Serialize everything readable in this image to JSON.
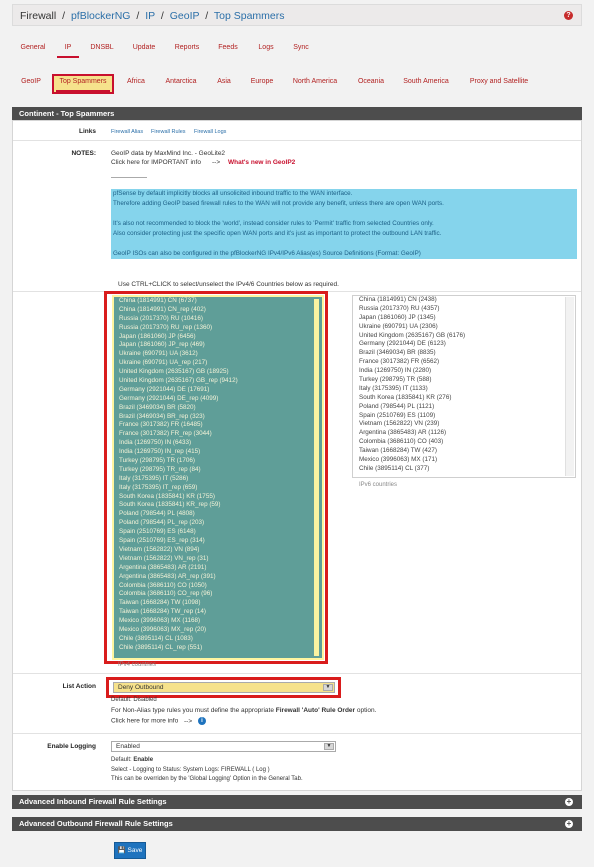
{
  "header": {
    "root": "Firewall",
    "crumbs": [
      "pfBlockerNG",
      "IP",
      "GeoIP",
      "Top Spammers"
    ],
    "sep": "/"
  },
  "main_tabs": [
    "General",
    "IP",
    "DNSBL",
    "Update",
    "Reports",
    "Feeds",
    "Logs",
    "Sync"
  ],
  "sub_tabs": [
    "GeoIP",
    "Top Spammers",
    "Africa",
    "Antarctica",
    "Asia",
    "Europe",
    "North America",
    "Oceania",
    "South America",
    "Proxy and Satellite"
  ],
  "panel_title": "Continent - Top Spammers",
  "links": {
    "label": "Links",
    "items": [
      "Firewall Alias",
      "Firewall Rules",
      "Firewall Logs"
    ]
  },
  "notes": {
    "label": "NOTES:",
    "line1": "GeoIP data by MaxMind Inc. - GeoLite2",
    "line2": "Click here for IMPORTANT info",
    "arrow": "-->",
    "whats_new": "What's new in GeoIP2",
    "info_lines": [
      "pfSense by default implicitly blocks all unsolicited inbound traffic to the WAN interface.",
      "Therefore adding GeoIP based firewall rules to the WAN will not provide any benefit, unless there are open WAN ports.",
      "",
      "It's also not recommended to block the 'world', instead consider rules to 'Permit' traffic from selected Countries only.",
      "Also consider protecting just the specific open WAN ports and it's just as important to protect the outbound LAN traffic.",
      "",
      "GeoIP ISOs can also be configured in the pfBlockerNG IPv4/IPv6 Alias(es) Source Definitions (Format: GeoIP)"
    ],
    "use_line": "Use    CTRL+CLICK    to    select/unselect    the IPv4/6 Countries below as required."
  },
  "ipv4_countries": [
    "China (1814991) CN (6737)",
    "China (1814991) CN_rep (402)",
    "Russia (2017370) RU (10416)",
    "Russia (2017370) RU_rep (1360)",
    "Japan (1861060) JP (6456)",
    "Japan (1861060) JP_rep (469)",
    "Ukraine (690791) UA (3612)",
    "Ukraine (690791) UA_rep (217)",
    "United Kingdom (2635167) GB (18925)",
    "United Kingdom (2635167) GB_rep (9412)",
    "Germany (2921044) DE (17691)",
    "Germany (2921044) DE_rep (4099)",
    "Brazil (3469034) BR (5820)",
    "Brazil (3469034) BR_rep (323)",
    "France (3017382) FR (16485)",
    "France (3017382) FR_rep (3044)",
    "India (1269750) IN (6433)",
    "India (1269750) IN_rep (415)",
    "Turkey (298795) TR (1706)",
    "Turkey (298795) TR_rep (84)",
    "Italy (3175395) IT (5286)",
    "Italy (3175395) IT_rep (659)",
    "South Korea (1835841) KR (1755)",
    "South Korea (1835841) KR_rep (59)",
    "Poland (798544) PL (4808)",
    "Poland (798544) PL_rep (203)",
    "Spain (2510769) ES (6148)",
    "Spain (2510769) ES_rep (314)",
    "Vietnam (1562822) VN (894)",
    "Vietnam (1562822) VN_rep (31)",
    "Argentina (3865483) AR (2191)",
    "Argentina (3865483) AR_rep (391)",
    "Colombia (3686110) CO (1050)",
    "Colombia (3686110) CO_rep (96)",
    "Taiwan (1668284) TW (1098)",
    "Taiwan (1668284) TW_rep (14)",
    "Mexico (3996063) MX (1168)",
    "Mexico (3996063) MX_rep (20)",
    "Chile (3895114) CL (1083)",
    "Chile (3895114) CL_rep (551)"
  ],
  "ipv4_caption": "IPv4 countries",
  "ipv6_countries": [
    "China (1814991) CN (2438)",
    "Russia (2017370) RU (4357)",
    "Japan (1861060) JP (1345)",
    "Ukraine (690791) UA (2306)",
    "United Kingdom (2635167) GB (6176)",
    "Germany (2921044) DE (6123)",
    "Brazil (3469034) BR (8835)",
    "France (3017382) FR (6562)",
    "India (1269750) IN (2280)",
    "Turkey (298795) TR (588)",
    "Italy (3175395) IT (1133)",
    "South Korea (1835841) KR (276)",
    "Poland (798544) PL (1121)",
    "Spain (2510769) ES (1109)",
    "Vietnam (1562822) VN (239)",
    "Argentina (3865483) AR (1126)",
    "Colombia (3686110) CO (403)",
    "Taiwan (1668284) TW (427)",
    "Mexico (3996063) MX (171)",
    "Chile (3895114) CL (377)"
  ],
  "ipv6_caption": "IPv6 countries",
  "list_action": {
    "label": "List Action",
    "value": "Deny Outbound",
    "default": "Default: Disabled",
    "note_prefix": "For Non-Alias type rules you must define the appropriate",
    "note_bold": "Firewall 'Auto' Rule Order",
    "note_suffix": "option.",
    "more_info": "Click here for more info",
    "arrow": "-->"
  },
  "logging": {
    "label": "Enable Logging",
    "value": "Enabled",
    "default_label": "Default:",
    "default_value": "Enable",
    "line1": "Select - Logging to Status: System Logs: FIREWALL ( Log )",
    "line2": "This can be overriden by the 'Global Logging' Option in the General Tab."
  },
  "sections": [
    "Advanced Inbound Firewall Rule Settings",
    "Advanced Outbound Firewall Rule Settings"
  ],
  "save_label": "Save",
  "colors": {
    "accent_red": "#c8102e",
    "link_blue": "#2b6fa8",
    "selected_list_bg": "#5f9e98",
    "info_bg": "#85d4ec"
  }
}
